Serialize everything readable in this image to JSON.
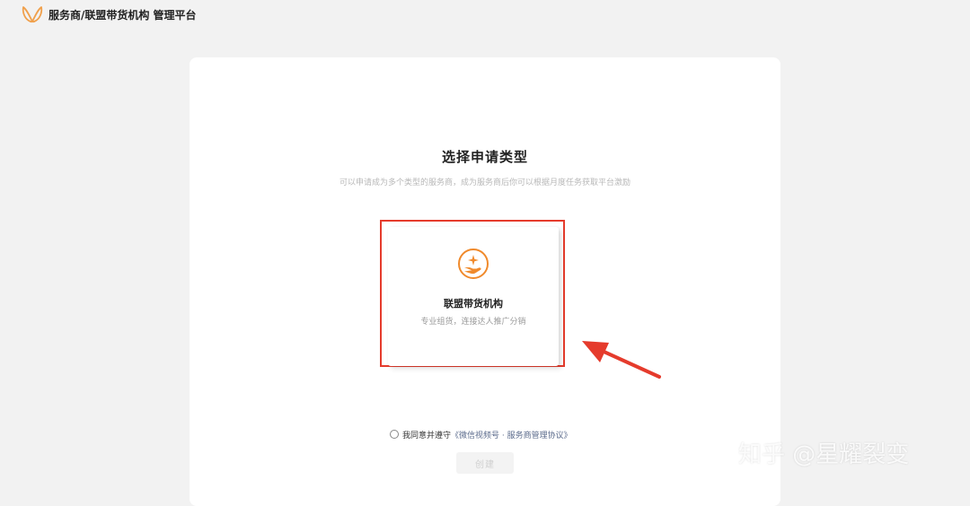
{
  "header": {
    "title": "服务商/联盟带货机构 管理平台",
    "logo_icon": "butterfly-logo",
    "logo_color": "#f0a04b"
  },
  "main": {
    "title": "选择申请类型",
    "subtitle": "可以申请成为多个类型的服务商，成为服务商后你可以根据月度任务获取平台激励"
  },
  "option": {
    "icon": "hand-star-icon",
    "icon_color": "#f08a2c",
    "title": "联盟带货机构",
    "description": "专业组货，连接达人推广分销"
  },
  "agreement": {
    "text": "我同意并遵守",
    "link": "《微信视频号 · 服务商管理协议》",
    "checked": false
  },
  "actions": {
    "create_label": "创建",
    "create_enabled": false
  },
  "annotation": {
    "highlight_color": "#e53b2c"
  },
  "watermark": "知乎 @星耀裂变"
}
